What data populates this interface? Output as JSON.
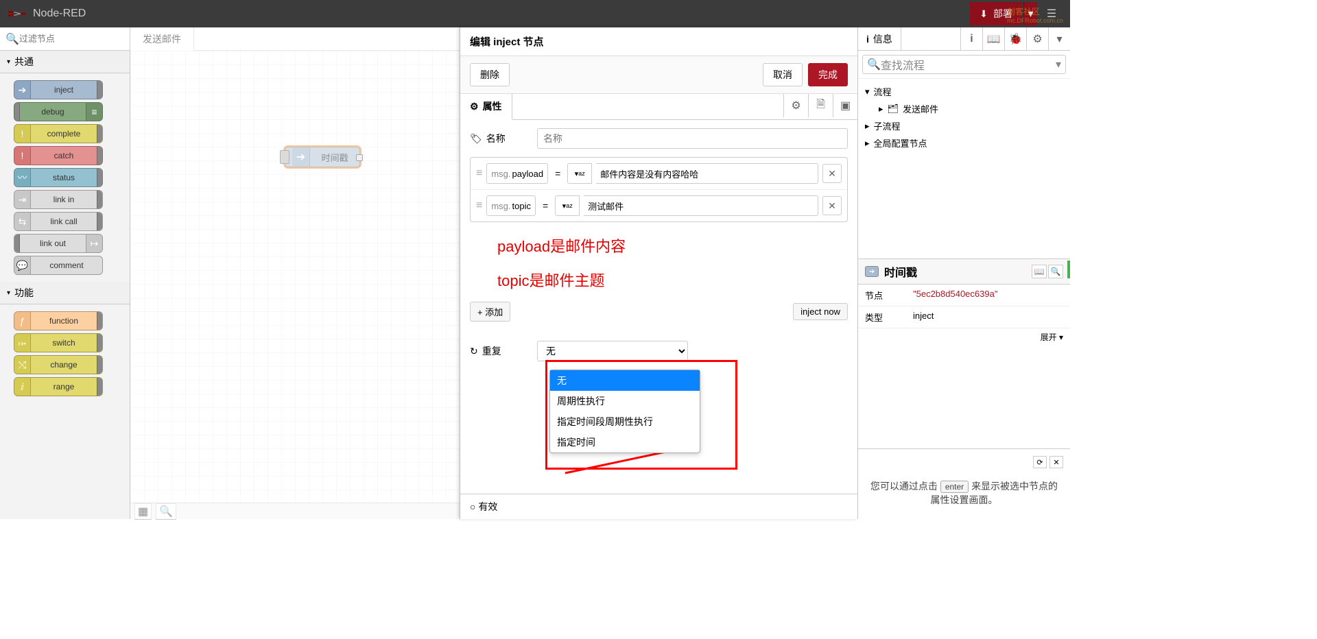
{
  "header": {
    "title": "Node-RED",
    "deploy": "部署",
    "watermark_top": "创客社区",
    "watermark_bottom": "mc.DFRobot.com.cn"
  },
  "palette": {
    "filter_placeholder": "过滤节点",
    "cat_common": "共通",
    "cat_function": "功能",
    "nodes_common": {
      "inject": "inject",
      "debug": "debug",
      "complete": "complete",
      "catch": "catch",
      "status": "status",
      "link_in": "link in",
      "link_call": "link call",
      "link_out": "link out",
      "comment": "comment"
    },
    "nodes_function": {
      "function": "function",
      "switch": "switch",
      "change": "change",
      "range": "range"
    }
  },
  "workspace": {
    "tab": "发送邮件",
    "node_label": "时间戳"
  },
  "edit": {
    "title": "编辑 inject 节点",
    "delete": "删除",
    "cancel": "取消",
    "done": "完成",
    "tab_props": "属性",
    "name_label": "名称",
    "name_placeholder": "名称",
    "msg_prefix": "msg.",
    "rows": {
      "payload_key": "payload",
      "payload_val": "邮件内容是没有内容哈哈",
      "topic_key": "topic",
      "topic_val": "测试邮件"
    },
    "annotation1": "payload是邮件内容",
    "annotation2": "topic是邮件主题",
    "add": "添加",
    "inject_now": "inject now",
    "repeat_label": "重复",
    "repeat_value": "无",
    "dropdown": {
      "opt0": "无",
      "opt1": "周期性执行",
      "opt2": "指定时间段周期性执行",
      "opt3": "指定时间"
    },
    "valid": "有效"
  },
  "sidebar": {
    "tab_info": "信息",
    "search_placeholder": "查找流程",
    "flows": "流程",
    "flow_item": "发送邮件",
    "subflows": "子流程",
    "globalcfg": "全局配置节点",
    "node_name": "时间戳",
    "node_label": "节点",
    "node_id": "\"5ec2b8d540ec639a\"",
    "type_label": "类型",
    "type_val": "inject",
    "expand": "展开",
    "tip_pre": "您可以通过点击",
    "tip_key": "enter",
    "tip_post": "来显示被选中节点的属性设置画面。"
  }
}
